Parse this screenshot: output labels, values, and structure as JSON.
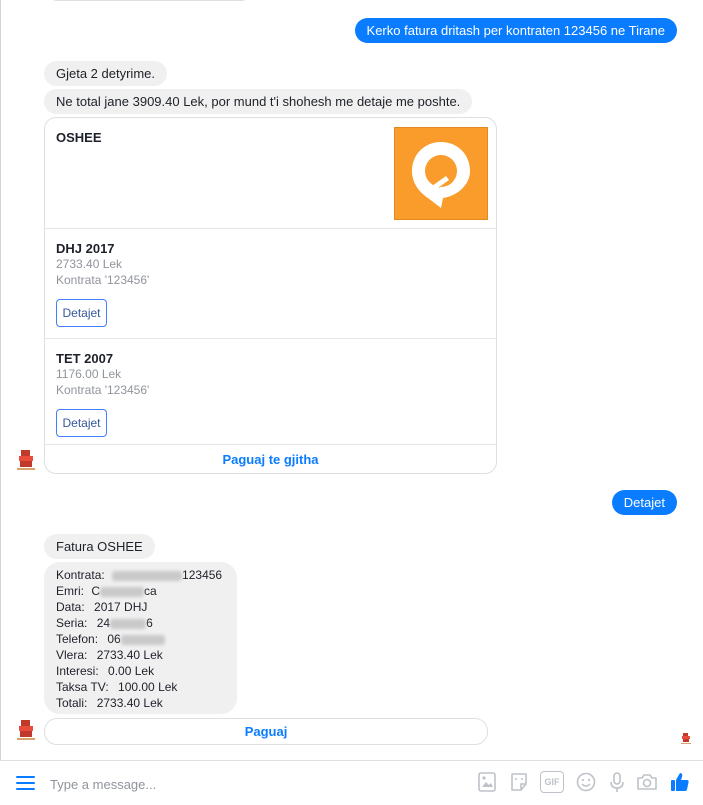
{
  "conversation": {
    "user_request": "Kerko fatura dritash per kontraten 123456 ne Tirane",
    "found_text": "Gjeta 2 detyrime.",
    "total_text": "Ne total jane 3909.40 Lek, por mund t'i shohesh me detaje me poshte.",
    "user_details": "Detajet",
    "invoice_header": "Fatura OSHEE"
  },
  "card": {
    "provider": "OSHEE",
    "items": [
      {
        "title": "DHJ 2017",
        "amount": "2733.40 Lek",
        "contract": "Kontrata '123456'",
        "button": "Detajet"
      },
      {
        "title": "TET 2007",
        "amount": "1176.00 Lek",
        "contract": "Kontrata '123456'",
        "button": "Detajet"
      }
    ],
    "pay_all": "Paguaj te gjitha"
  },
  "details": {
    "rows": [
      {
        "label": "Kontrata:",
        "value": "123456"
      },
      {
        "label": "Emri:",
        "value_start": "C",
        "value_end": "ca"
      },
      {
        "label": "Data:",
        "value": "2017 DHJ"
      },
      {
        "label": "Seria:",
        "value_start": "24",
        "value_end": "6"
      },
      {
        "label": "Telefon:",
        "value_start": "06"
      },
      {
        "label": "Vlera:",
        "value": "2733.40 Lek"
      },
      {
        "label": "Interesi:",
        "value": "0.00 Lek"
      },
      {
        "label": "Taksa TV:",
        "value": "100.00 Lek"
      },
      {
        "label": "Totali:",
        "value": "2733.40 Lek"
      }
    ],
    "pay_button": "Paguaj"
  },
  "composer": {
    "placeholder": "Type a message...",
    "gif_label": "GIF"
  },
  "colors": {
    "messenger_blue": "#0a7cff",
    "bubble_gray": "#f1f0f0",
    "oshee_orange": "#f99c2b"
  },
  "icons": [
    "menu-icon",
    "image-icon",
    "sticker-icon",
    "gif-icon",
    "emoji-icon",
    "microphone-icon",
    "camera-icon",
    "thumbs-up-icon",
    "bot-avatar-icon"
  ]
}
